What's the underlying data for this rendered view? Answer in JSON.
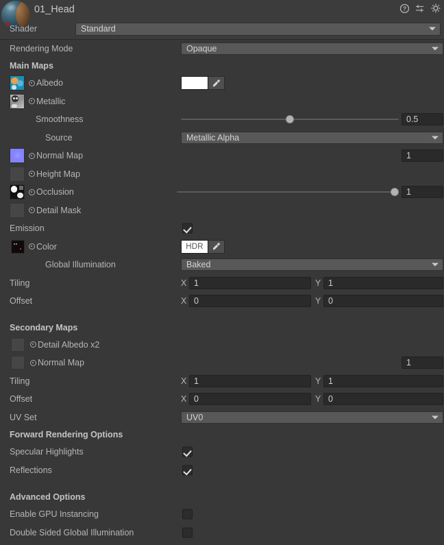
{
  "window": {
    "material_name": "01_Head",
    "preview_icon": "material-sphere-preview"
  },
  "header_icons": [
    {
      "name": "help-icon",
      "glyph": "?"
    },
    {
      "name": "preset-icon",
      "glyph": "sliders"
    },
    {
      "name": "settings-gear-icon",
      "glyph": "gear"
    }
  ],
  "shader": {
    "label": "Shader",
    "value": "Standard"
  },
  "rendering_mode": {
    "label": "Rendering Mode",
    "value": "Opaque"
  },
  "sections": {
    "main_maps": "Main Maps",
    "secondary_maps": "Secondary Maps",
    "forward_rendering_options": "Forward Rendering Options",
    "advanced_options": "Advanced Options"
  },
  "main_maps": {
    "albedo": {
      "label": "Albedo",
      "color_value": "",
      "color_hex": "#ffffff",
      "texture": "albedo-thumb"
    },
    "metallic": {
      "label": "Metallic",
      "texture": "metallic-thumb"
    },
    "smoothness": {
      "label": "Smoothness",
      "value": "0.5",
      "slider_percent": 50
    },
    "source": {
      "label": "Source",
      "value": "Metallic Alpha"
    },
    "normal_map": {
      "label": "Normal Map",
      "value": "1",
      "texture": "normal-thumb"
    },
    "height_map": {
      "label": "Height Map",
      "texture": "empty-thumb"
    },
    "occlusion": {
      "label": "Occlusion",
      "value": "1",
      "slider_percent": 100,
      "texture": "occlusion-thumb"
    },
    "detail_mask": {
      "label": "Detail Mask",
      "texture": "empty-thumb"
    }
  },
  "emission": {
    "label": "Emission",
    "enabled": true,
    "color": {
      "label": "Color",
      "swatch_text": "HDR",
      "texture": "emission-thumb"
    },
    "global_illumination": {
      "label": "Global Illumination",
      "value": "Baked"
    }
  },
  "main_tiling": {
    "tiling": {
      "label": "Tiling",
      "x_label": "X",
      "x": "1",
      "y_label": "Y",
      "y": "1"
    },
    "offset": {
      "label": "Offset",
      "x_label": "X",
      "x": "0",
      "y_label": "Y",
      "y": "0"
    }
  },
  "secondary_maps": {
    "detail_albedo": {
      "label": "Detail Albedo x2",
      "texture": "empty-thumb"
    },
    "normal_map": {
      "label": "Normal Map",
      "value": "1",
      "texture": "empty-thumb"
    },
    "tiling": {
      "label": "Tiling",
      "x_label": "X",
      "x": "1",
      "y_label": "Y",
      "y": "1"
    },
    "offset": {
      "label": "Offset",
      "x_label": "X",
      "x": "0",
      "y_label": "Y",
      "y": "0"
    },
    "uv_set": {
      "label": "UV Set",
      "value": "UV0"
    }
  },
  "forward_rendering": {
    "specular_highlights": {
      "label": "Specular Highlights",
      "enabled": true
    },
    "reflections": {
      "label": "Reflections",
      "enabled": true
    }
  },
  "advanced": {
    "gpu_instancing": {
      "label": "Enable GPU Instancing",
      "enabled": false
    },
    "double_sided_gi": {
      "label": "Double Sided Global Illumination",
      "enabled": false
    }
  },
  "colors": {
    "background": "#383838",
    "header_background": "#3c3c3c",
    "dropdown": "#585858",
    "field": "#2a2a2a",
    "text": "#b6b6b6",
    "normal_map_swatch": "#8583ff",
    "albedo_swatch": "#ffffff"
  }
}
